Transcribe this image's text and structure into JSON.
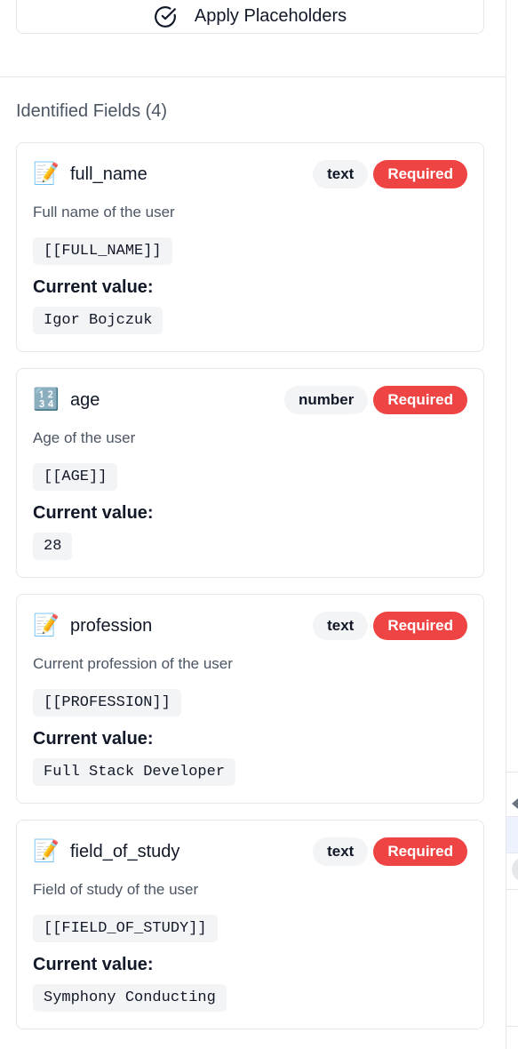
{
  "toolbar": {
    "apply_label": "Apply Placeholders"
  },
  "section": {
    "title": "Identified Fields (4)"
  },
  "labels": {
    "current_value": "Current value:"
  },
  "fields": [
    {
      "icon": "📝",
      "name": "full_name",
      "type": "text",
      "required": "Required",
      "description": "Full name of the user",
      "placeholder": "[[FULL_NAME]]",
      "current_value": "Igor Bojczuk"
    },
    {
      "icon": "🔢",
      "name": "age",
      "type": "number",
      "required": "Required",
      "description": "Age of the user",
      "placeholder": "[[AGE]]",
      "current_value": "28"
    },
    {
      "icon": "📝",
      "name": "profession",
      "type": "text",
      "required": "Required",
      "description": "Current profession of the user",
      "placeholder": "[[PROFESSION]]",
      "current_value": "Full Stack Developer"
    },
    {
      "icon": "📝",
      "name": "field_of_study",
      "type": "text",
      "required": "Required",
      "description": "Field of study of the user",
      "placeholder": "[[FIELD_OF_STUDY]]",
      "current_value": "Symphony Conducting"
    }
  ],
  "colors": {
    "required_badge": "#ef4444",
    "type_badge": "#f3f4f6",
    "border": "#e5e7eb",
    "muted_text": "#4b5563"
  }
}
